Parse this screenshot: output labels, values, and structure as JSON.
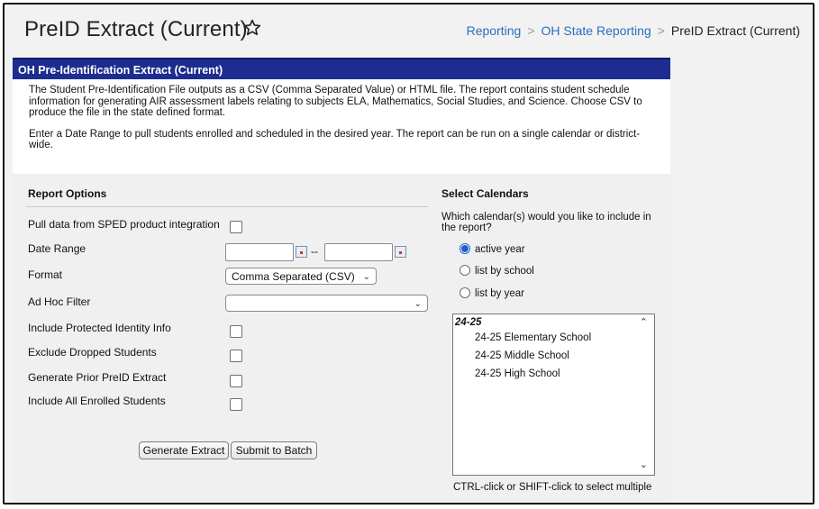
{
  "header": {
    "title": "PreID Extract (Current)",
    "favorite_icon": "star-outline-icon",
    "breadcrumb": {
      "items": [
        "Reporting",
        "OH State Reporting"
      ],
      "current": "PreID Extract (Current)",
      "separator": ">"
    }
  },
  "banner": {
    "title": "OH Pre-Identification Extract (Current)",
    "color": "#1d2d8f"
  },
  "description": {
    "p1": "The Student Pre-Identification File outputs as a CSV (Comma Separated Value) or HTML file. The report contains student schedule information for generating AIR assessment labels relating to subjects ELA, Mathematics, Social Studies, and Science. Choose CSV to produce the file in the state defined format.",
    "p2": "Enter a Date Range to pull students enrolled and scheduled in the desired year. The report can be run on a single calendar or district-wide."
  },
  "report_options": {
    "heading": "Report Options",
    "sped_label": "Pull data from SPED product integration",
    "sped_checked": false,
    "date_range_label": "Date Range",
    "date_start": "",
    "date_end": "",
    "date_separator": "--",
    "format_label": "Format",
    "format_value": "Comma Separated (CSV)",
    "adhoc_label": "Ad Hoc Filter",
    "adhoc_value": "",
    "protected_label": "Include Protected Identity Info",
    "dropped_label": "Exclude Dropped Students",
    "prior_label": "Generate Prior PreID Extract",
    "enrolled_label": "Include All Enrolled Students"
  },
  "buttons": {
    "generate": "Generate Extract",
    "batch": "Submit to Batch"
  },
  "calendars": {
    "heading": "Select Calendars",
    "question": "Which calendar(s) would you like to include in the report?",
    "radio_options": [
      "active year",
      "list by school",
      "list by year"
    ],
    "selected_radio": "active year",
    "group": "24-25",
    "items": [
      "24-25 Elementary School",
      "24-25 Middle School",
      "24-25 High School"
    ],
    "hint": "CTRL-click or SHIFT-click to select multiple"
  }
}
